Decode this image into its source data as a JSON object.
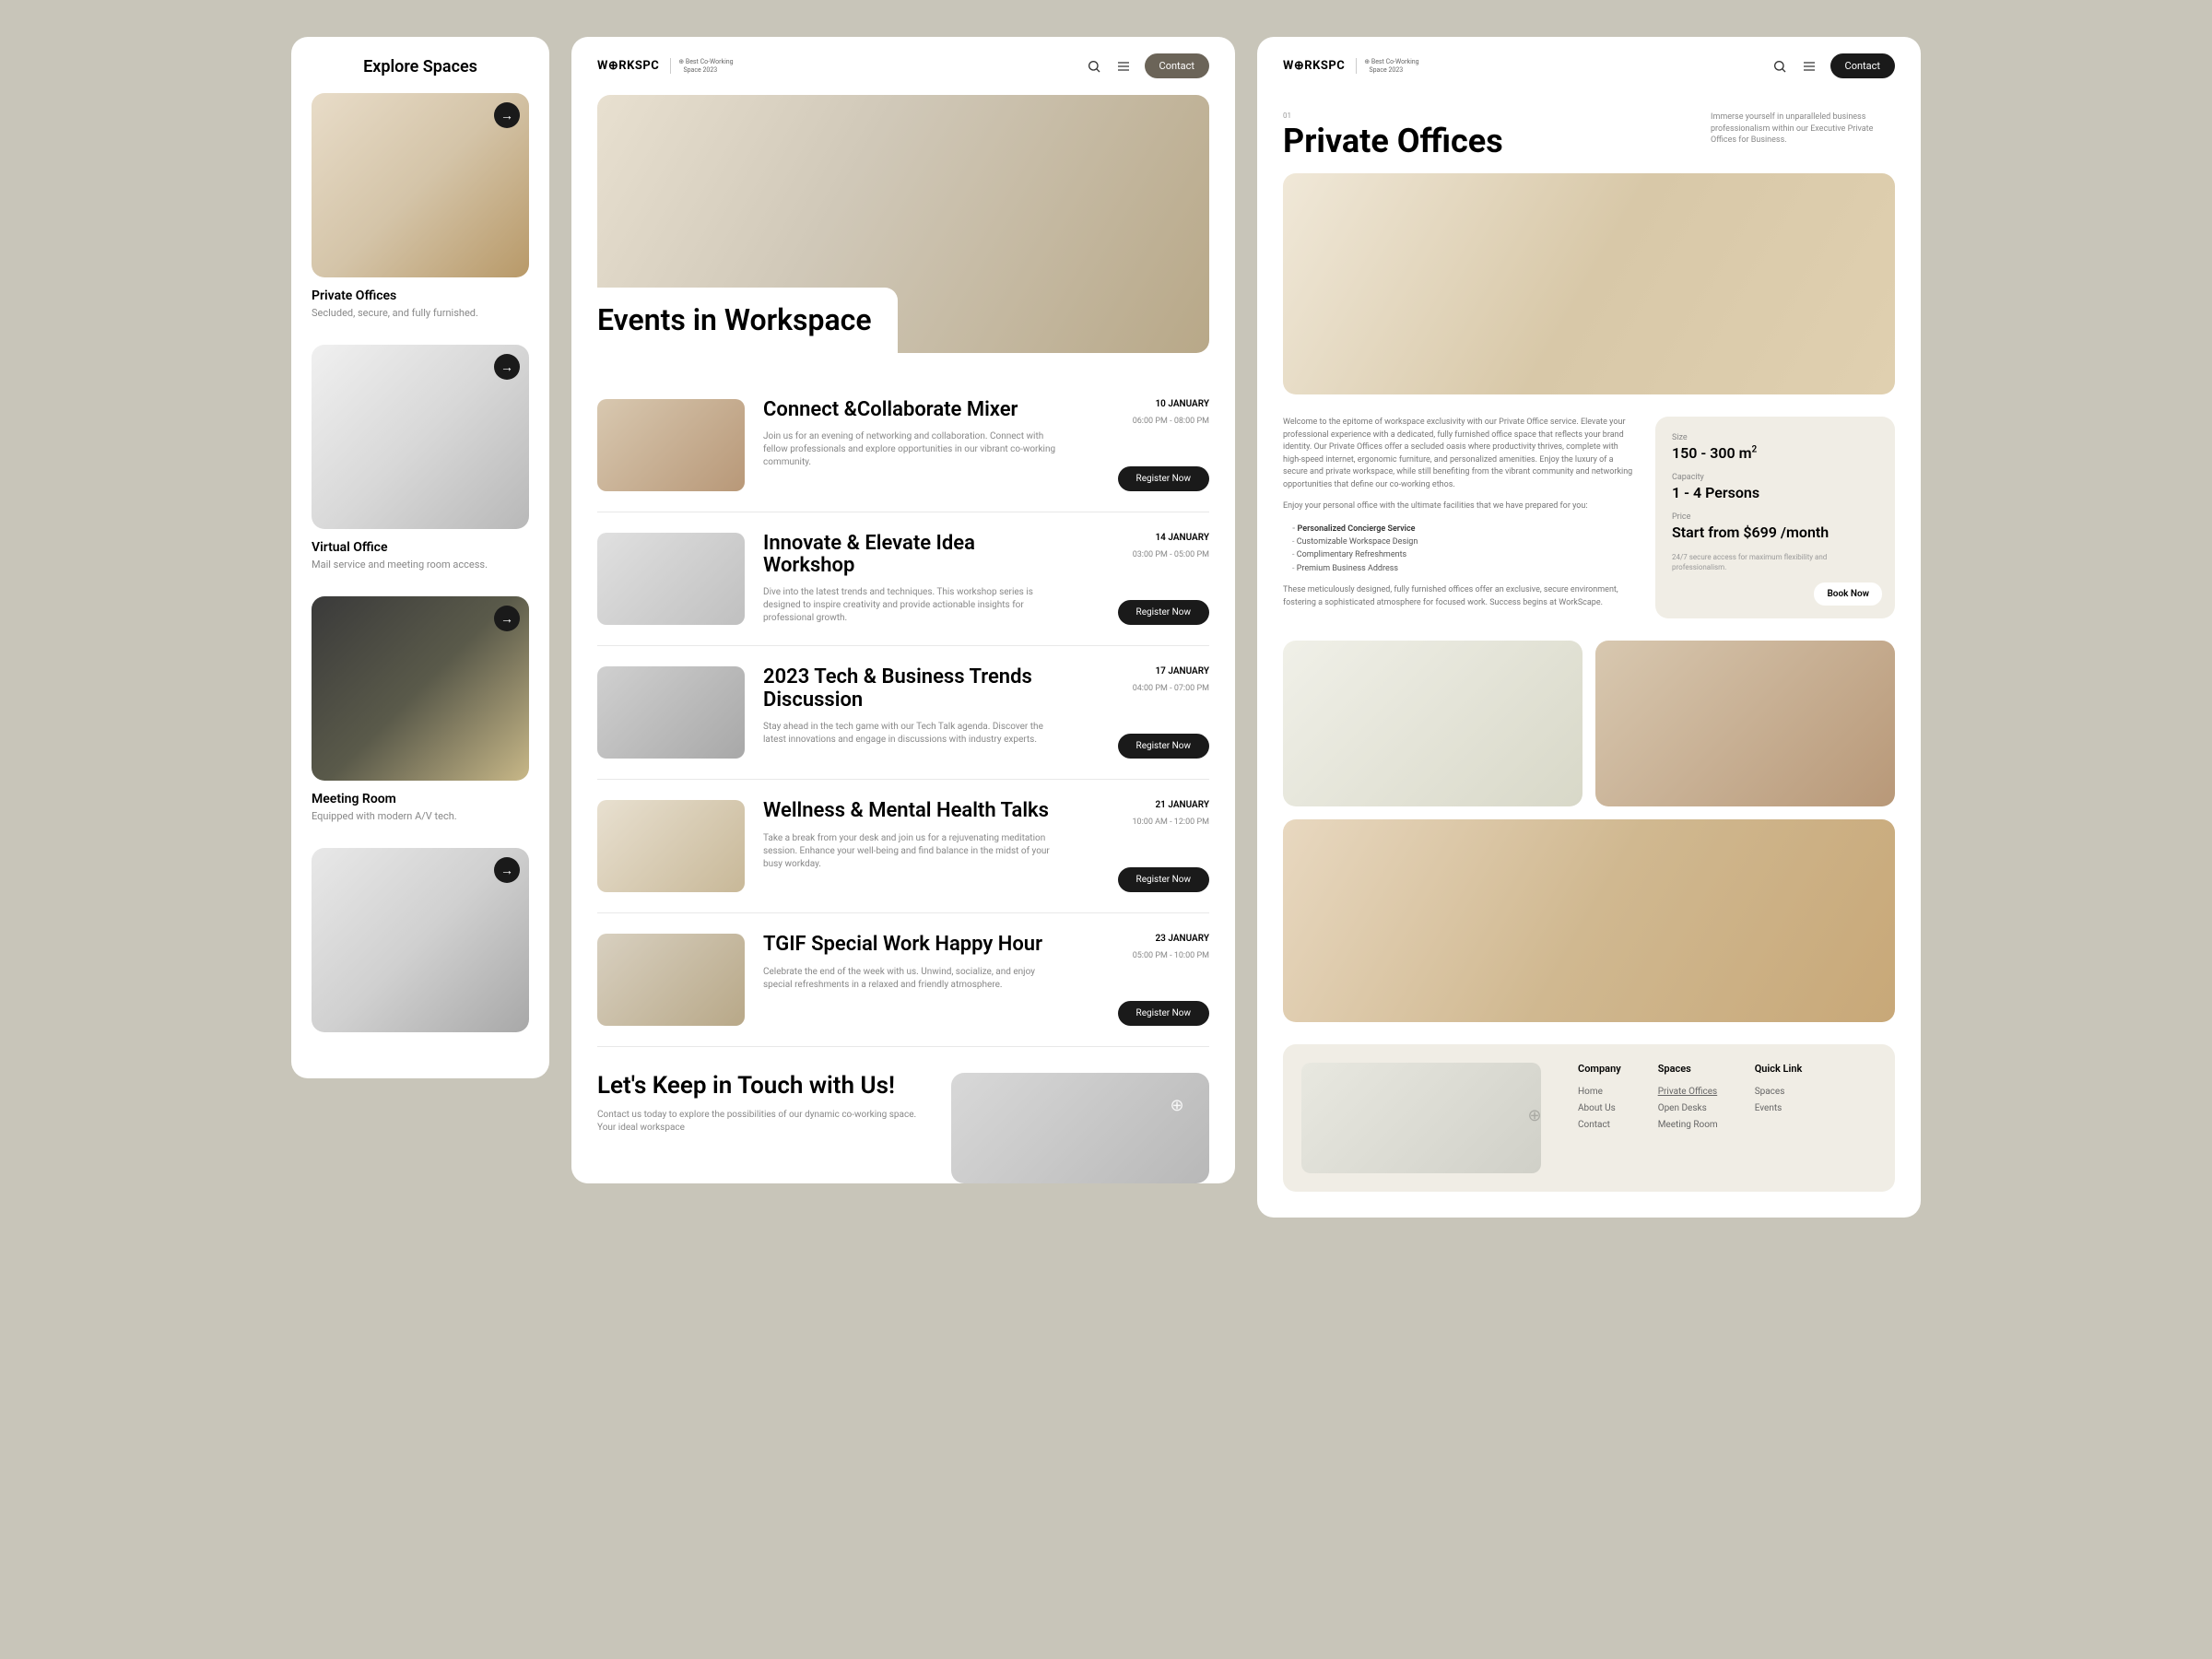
{
  "explore": {
    "title": "Explore Spaces",
    "spaces": [
      {
        "name": "Private Offices",
        "desc": "Secluded, secure, and fully furnished."
      },
      {
        "name": "Virtual Office",
        "desc": "Mail service and meeting room access."
      },
      {
        "name": "Meeting Room",
        "desc": "Equipped with modern A/V tech."
      }
    ]
  },
  "header": {
    "logo": "W⊕RKSPC",
    "badge_line1": "Best Co-Working",
    "badge_line2": "Space 2023",
    "contact": "Contact"
  },
  "events": {
    "hero_title": "Events in Workspace",
    "items": [
      {
        "title": "Connect &Collaborate Mixer",
        "desc": "Join us for an evening of networking and collaboration. Connect with fellow professionals and explore opportunities in our vibrant co-working community.",
        "date": "10 JANUARY",
        "time": "06:00 PM - 08:00 PM",
        "btn": "Register Now"
      },
      {
        "title": "Innovate & Elevate Idea Workshop",
        "desc": "Dive into the latest trends and techniques. This workshop series is designed to inspire creativity and provide actionable insights for professional growth.",
        "date": "14 JANUARY",
        "time": "03:00 PM - 05:00 PM",
        "btn": "Register Now"
      },
      {
        "title": "2023 Tech & Business Trends Discussion",
        "desc": "Stay ahead in the tech game with our Tech Talk agenda. Discover the latest innovations and engage in discussions with industry experts.",
        "date": "17 JANUARY",
        "time": "04:00 PM - 07:00 PM",
        "btn": "Register Now"
      },
      {
        "title": "Wellness & Mental Health Talks",
        "desc": "Take a break from your desk and join us for a rejuvenating meditation session. Enhance your well-being and find balance in the midst of your busy workday.",
        "date": "21 JANUARY",
        "time": "10:00 AM - 12:00 PM",
        "btn": "Register Now"
      },
      {
        "title": "TGIF Special Work Happy Hour",
        "desc": "Celebrate the end of the week with us. Unwind, socialize, and enjoy special refreshments in a relaxed and friendly atmosphere.",
        "date": "23 JANUARY",
        "time": "05:00 PM - 10:00 PM",
        "btn": "Register Now"
      }
    ],
    "cta_title": "Let's Keep in Touch with Us!",
    "cta_desc": "Contact us today to explore the possibilities of our dynamic co-working space. Your ideal workspace"
  },
  "po": {
    "num": "01",
    "title": "Private Offices",
    "sub": "Immerse yourself in unparalleled business professionalism within our Executive Private Offices for Business.",
    "para1": "Welcome to the epitome of workspace exclusivity with our Private Office service. Elevate your professional experience with a dedicated, fully furnished office space that reflects your brand identity. Our Private Offices offer a secluded oasis where productivity thrives, complete with high-speed internet, ergonomic furniture, and personalized amenities. Enjoy the luxury of a secure and private workspace, while still benefiting from the vibrant community and networking opportunities that define our co-working ethos.",
    "para2": "Enjoy your personal office with the ultimate facilities that we have prepared for you:",
    "features": [
      "Personalized Concierge Service",
      "Customizable Workspace Design",
      "Complimentary Refreshments",
      "Premium Business Address"
    ],
    "para3": "These meticulously designed, fully furnished offices offer an exclusive, secure environment, fostering a sophisticated atmosphere for focused work. Success begins at WorkScape.",
    "info": {
      "size_label": "Size",
      "size_value": "150 - 300 m²",
      "capacity_label": "Capacity",
      "capacity_value": "1 - 4 Persons",
      "price_label": "Price",
      "price_value": "Start from $699 /month",
      "note": "24/7 secure access for maximum flexibility and professionalism.",
      "book": "Book Now"
    }
  },
  "footer": {
    "cols": [
      {
        "h": "Company",
        "links": [
          "Home",
          "About Us",
          "Contact"
        ]
      },
      {
        "h": "Spaces",
        "links": [
          "Private Offices",
          "Open Desks",
          "Meeting Room"
        ]
      },
      {
        "h": "Quick Link",
        "links": [
          "Spaces",
          "Events"
        ]
      }
    ]
  }
}
